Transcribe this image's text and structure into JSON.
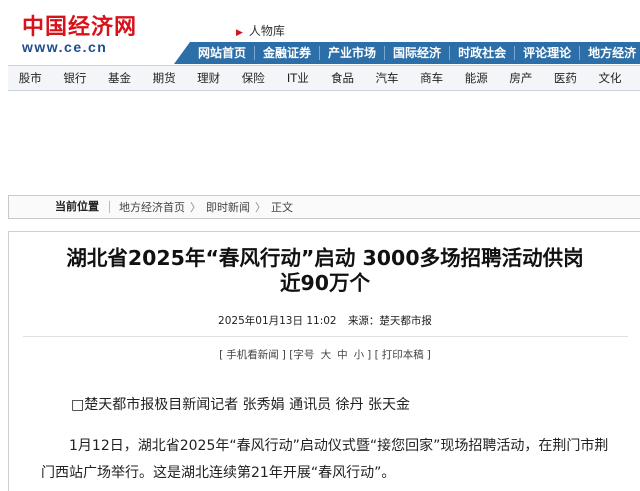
{
  "header": {
    "logo_cn": "中国经济网",
    "logo_url": "www.ce.cn",
    "channel": "人物库"
  },
  "top_nav": [
    "网站首页",
    "金融证券",
    "产业市场",
    "国际经济",
    "时政社会",
    "评论理论",
    "地方经济"
  ],
  "sub_nav": [
    "股市",
    "银行",
    "基金",
    "期货",
    "理财",
    "保险",
    "IT业",
    "食品",
    "汽车",
    "商车",
    "能源",
    "房产",
    "医药",
    "文化"
  ],
  "breadcrumb": {
    "label": "当前位置",
    "items": [
      "地方经济首页",
      "即时新闻",
      "正文"
    ],
    "separator": "〉"
  },
  "article": {
    "title_line1": "湖北省2025年“春风行动”启动 3000多场招聘活动供岗",
    "title_line2": "近90万个",
    "datetime": "2025年01月13日 11:02",
    "source": "来源：楚天都市报",
    "tools": {
      "mobile": "手机看新闻",
      "font_size_label": "字号",
      "size_large": "大",
      "size_medium": "中",
      "size_small": "小",
      "print": "打印本稿"
    },
    "byline": "□楚天都市报极目新闻记者 张秀娟 通讯员 徐丹 张天金",
    "paragraph": "1月12日，湖北省2025年“春风行动”启动仪式暨“接您回家”现场招聘活动，在荆门市荆门西站广场举行。这是湖北连续第21年开展“春风行动”。"
  },
  "colors": {
    "logo_red": "#d7121b",
    "logo_blue": "#1f4e8c",
    "nav_blue": "#2b6ea8"
  }
}
